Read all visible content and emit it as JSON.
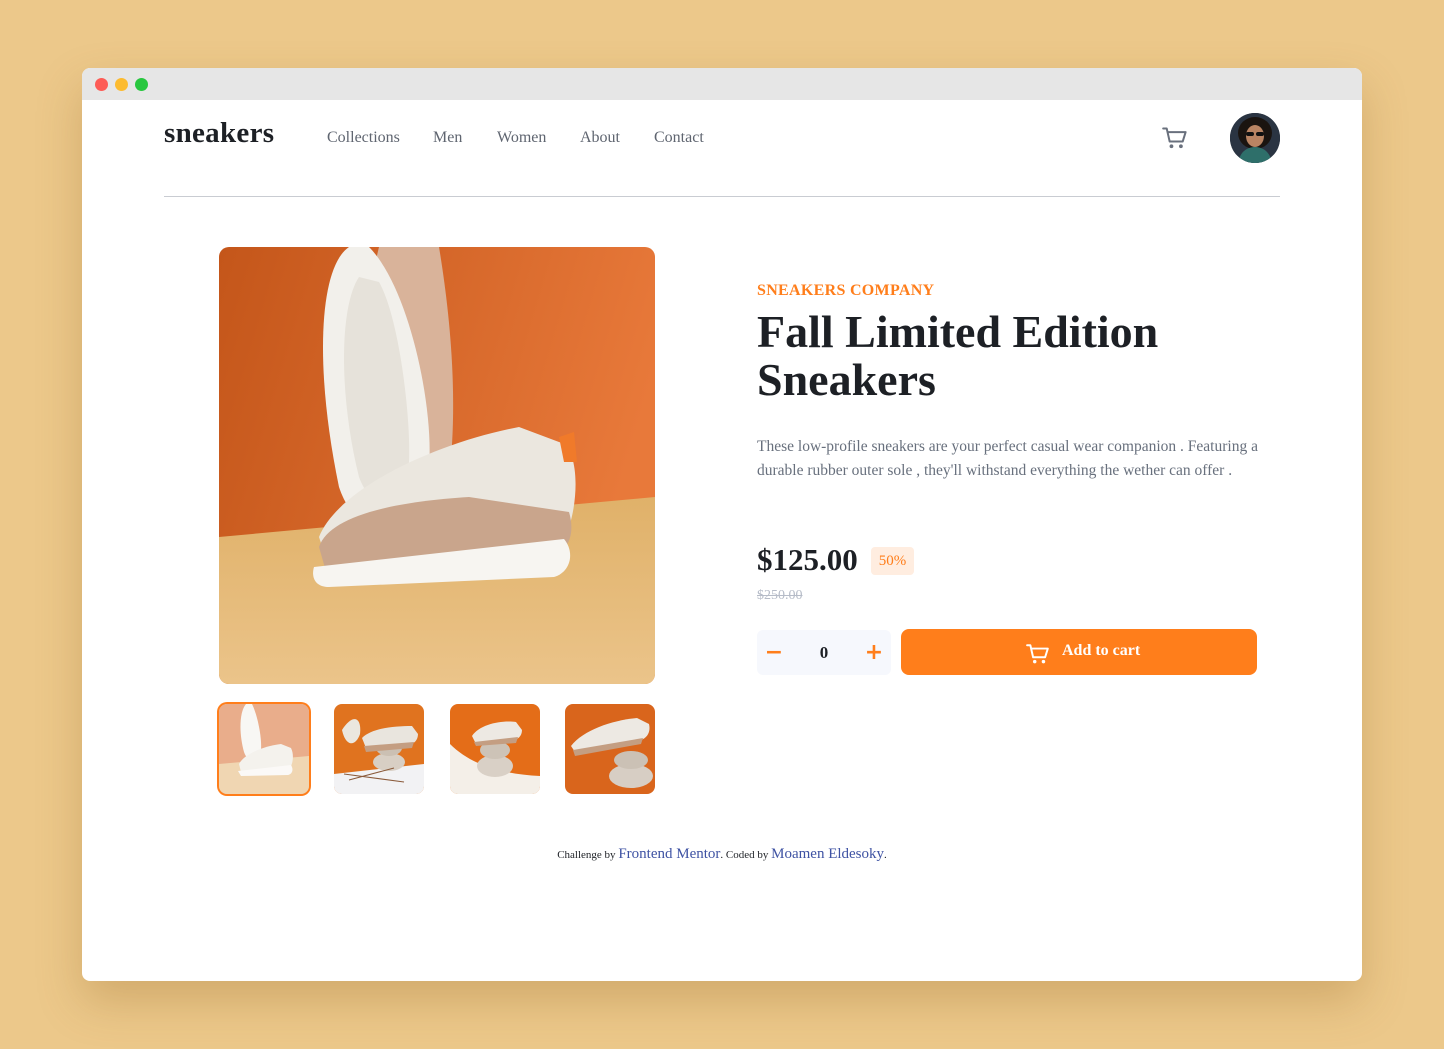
{
  "brand": {
    "logo": "sneakers"
  },
  "nav": {
    "items": [
      {
        "label": "Collections"
      },
      {
        "label": "Men"
      },
      {
        "label": "Women"
      },
      {
        "label": "About"
      },
      {
        "label": "Contact"
      }
    ]
  },
  "header_icons": {
    "cart_icon": "cart-icon",
    "avatar": "user-avatar"
  },
  "product": {
    "company": "SNEAKERS COMPANY",
    "title_line1": "Fall Limited Edition",
    "title_line2": "Sneakers",
    "description": "These low-profile sneakers are your perfect casual wear companion . Featuring a durable rubber outer sole , they'll withstand everything the wether can offer .",
    "price": "$125.00",
    "discount": "50%",
    "original_price": "$250.00"
  },
  "cart": {
    "quantity": "0",
    "minus_label": "−",
    "plus_label": "+",
    "add_to_cart_label": "Add to cart"
  },
  "gallery": {
    "thumbnails": [
      {
        "name": "thumbnail-1",
        "active": true
      },
      {
        "name": "thumbnail-2",
        "active": false
      },
      {
        "name": "thumbnail-3",
        "active": false
      },
      {
        "name": "thumbnail-4",
        "active": false
      }
    ]
  },
  "footer": {
    "prefix": "Challenge by ",
    "link1": "Frontend Mentor",
    "middle": ". Coded by ",
    "link2": "Moamen Eldesoky",
    "suffix": "."
  },
  "colors": {
    "accent": "#ff7e1b",
    "accent_pale": "#ffede0",
    "dark": "#1d2025",
    "text_grey": "#68707d",
    "page_bg": "#ecc88a"
  }
}
